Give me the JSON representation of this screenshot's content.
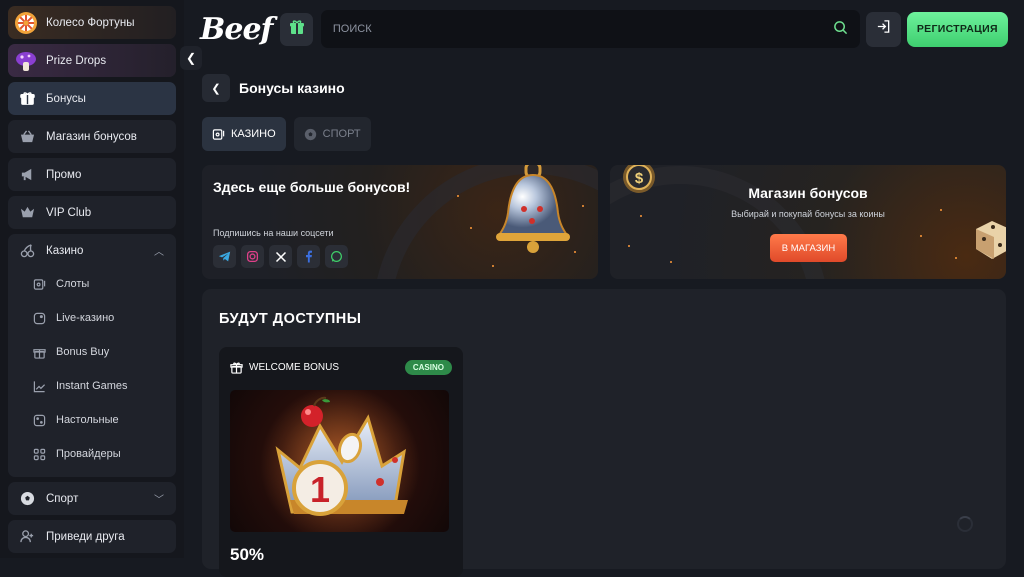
{
  "sidebar": {
    "wheel_label": "Колесо Фортуны",
    "prize_label": "Prize Drops",
    "items": [
      {
        "label": "Бонусы",
        "icon": "gift-icon"
      },
      {
        "label": "Магазин бонусов",
        "icon": "basket-icon"
      },
      {
        "label": "Промо",
        "icon": "megaphone-icon"
      },
      {
        "label": "VIP Club",
        "icon": "crown-icon"
      }
    ],
    "casino": {
      "label": "Казино",
      "sub": [
        {
          "label": "Слоты"
        },
        {
          "label": "Live-казино"
        },
        {
          "label": "Bonus Buy"
        },
        {
          "label": "Instant Games"
        },
        {
          "label": "Настольные"
        },
        {
          "label": "Провайдеры"
        }
      ]
    },
    "sport_label": "Спорт",
    "invite_label": "Приведи друга"
  },
  "header": {
    "logo": "Beef",
    "search_placeholder": "поиск",
    "register_label": "РЕГИСТРАЦИЯ"
  },
  "page": {
    "title": "Бонусы казино",
    "tabs": [
      {
        "label": "КАЗИНО"
      },
      {
        "label": "СПОРТ"
      }
    ]
  },
  "promo_social": {
    "title": "Здесь еще больше бонусов!",
    "subtitle": "Подпишись на наши соцсети"
  },
  "promo_shop": {
    "title": "Магазин бонусов",
    "subtitle": "Выбирай и покупай бонусы за коины",
    "button": "В МАГАЗИН"
  },
  "soon": {
    "title": "БУДУТ ДОСТУПНЫ",
    "card": {
      "title": "WELCOME BONUS",
      "badge": "CASINO",
      "value": "50%"
    }
  },
  "colors": {
    "accent_green": "#5ee08a",
    "shop_orange": "#ff6a3a",
    "badge_green": "#2e8a49"
  }
}
